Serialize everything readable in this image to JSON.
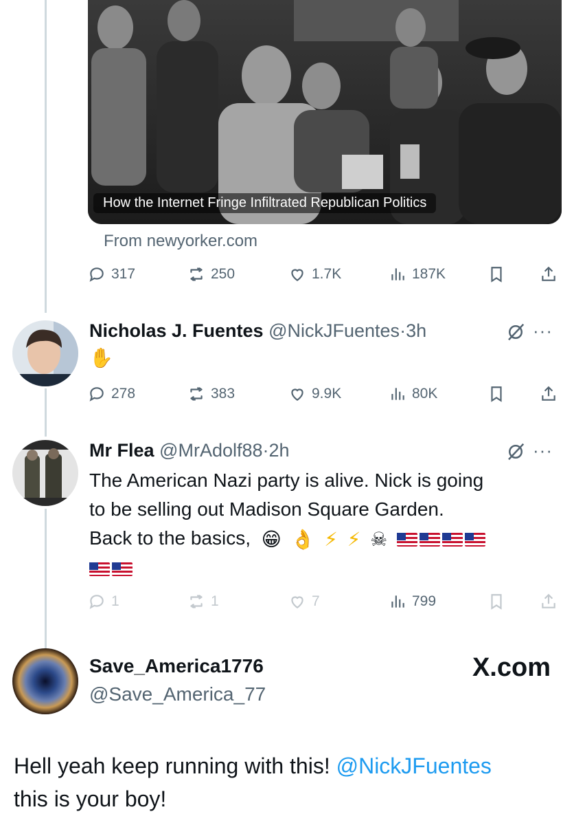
{
  "quoted_card": {
    "caption": "How the Internet Fringe Infiltrated Republican Politics",
    "source": "From newyorker.com",
    "stats": {
      "replies": "317",
      "reposts": "250",
      "likes": "1.7K",
      "views": "187K"
    }
  },
  "tweets": [
    {
      "name": "Nicholas J. Fuentes",
      "handle": "@NickJFuentes",
      "time": "3h",
      "text": "✋",
      "stats": {
        "replies": "278",
        "reposts": "383",
        "likes": "9.9K",
        "views": "80K"
      }
    },
    {
      "name": "Mr Flea",
      "handle": "@MrAdolf88",
      "time": "2h",
      "text_line1": "The  American Nazi party is alive. Nick is going",
      "text_line2": "to be selling out Madison Square Garden.",
      "text_line3": "Back to the basics,",
      "emoji": {
        "grin": "😁",
        "ok": "👌",
        "bolt": "⚡",
        "skull": "☠"
      },
      "stats": {
        "replies": "1",
        "reposts": "1",
        "likes": "7",
        "views": "799"
      }
    }
  ],
  "bottom_post": {
    "name": "Save_America1776",
    "handle": "@Save_America_77",
    "site": "X.com",
    "text_part1": "Hell yeah keep running with this! ",
    "mention": "@NickJFuentes",
    "text_part2": "this is your boy!"
  },
  "colors": {
    "accent": "#1d9bf0",
    "muted": "#536471",
    "text": "#0f1419",
    "thread_line": "#cfd9de"
  },
  "separator": "·"
}
